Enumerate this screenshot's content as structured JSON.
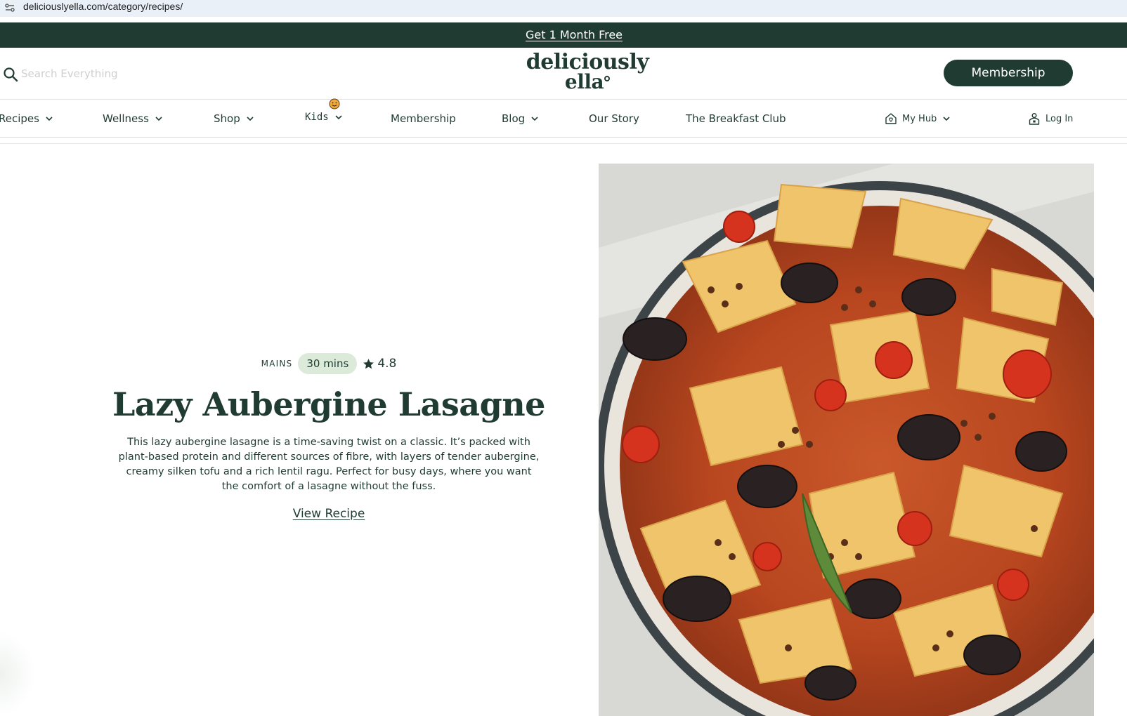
{
  "browser": {
    "url": "deliciouslyella.com/category/recipes/"
  },
  "promo": {
    "label": "Get 1 Month Free"
  },
  "header": {
    "search_placeholder": "Search Everything",
    "logo_line1": "deliciously",
    "logo_line2": "ella",
    "cta_label": "Membership"
  },
  "nav": {
    "items": [
      {
        "label": "Recipes",
        "dropdown": true
      },
      {
        "label": "Wellness",
        "dropdown": true
      },
      {
        "label": "Shop",
        "dropdown": true
      },
      {
        "label": "Kids",
        "dropdown": true,
        "icon": "smiley-icon"
      },
      {
        "label": "Membership",
        "dropdown": false
      },
      {
        "label": "Blog",
        "dropdown": true
      },
      {
        "label": "Our Story",
        "dropdown": false
      },
      {
        "label": "The Breakfast Club",
        "dropdown": false
      }
    ],
    "my_hub": {
      "label": "My Hub",
      "icon": "house-heart-icon"
    },
    "login": {
      "label": "Log In",
      "icon": "user-lock-icon"
    }
  },
  "hero": {
    "category": "MAINS",
    "time": "30 mins",
    "rating": "4.8",
    "title": "Lazy Aubergine Lasagne",
    "description": "This lazy aubergine lasagne is a time-saving twist on a classic. It’s packed with plant-based protein and different sources of fibre, with layers of tender aubergine, creamy silken tofu and a rich lentil ragu. Perfect for busy days, where you want the comfort of a lasagne without the fuss.",
    "link_label": "View Recipe"
  },
  "colors": {
    "brand_green": "#1f3b32",
    "pill_green": "#dcebd9",
    "kids_badge": "#f2a93b"
  }
}
